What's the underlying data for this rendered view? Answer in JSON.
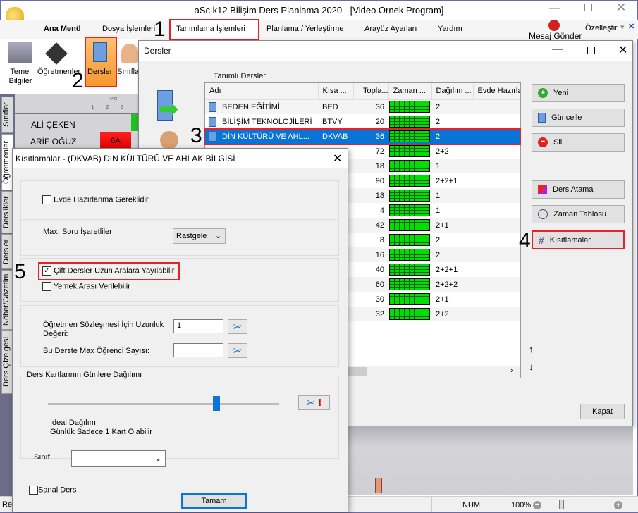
{
  "app": {
    "title": "aSc k12 Bilişim Ders Planlama 2020  - [Video Örnek Program]"
  },
  "menu": {
    "items": [
      "Ana Menü",
      "Dosya İşlemleri",
      "Tanımlama İşlemleri",
      "Planlama / Yerleştirme",
      "Arayüz Ayarları",
      "Yardım"
    ],
    "message": "Mesaj Gönder",
    "customize": "Özelleştir"
  },
  "ribbon": {
    "items": [
      "Temel Bilgiler",
      "Öğretmenler",
      "Dersler",
      "Sınıfla"
    ]
  },
  "side_tabs": [
    "Sınıflar",
    "Öğretmenler",
    "Derslikler",
    "Dersler",
    "Nöbet/Gözetim",
    "Ders Çizelgesi"
  ],
  "timetable": {
    "header": "Pzt",
    "periods": [
      "1",
      "2",
      "3"
    ],
    "rows": [
      {
        "name": "ALİ ÇEKEN"
      },
      {
        "name": "ARİF OĞUZ",
        "cell": "6A"
      }
    ]
  },
  "steps": [
    "1",
    "2",
    "3",
    "4",
    "5"
  ],
  "dersler": {
    "title": "Dersler",
    "list_label": "Tanımlı Dersler",
    "columns": [
      "Adı",
      "Kısa ...",
      "Topla...",
      "Zaman ...",
      "Dağılım ...",
      "Evde Hazırla"
    ],
    "rows": [
      {
        "name": "BEDEN EĞİTİMİ",
        "short": "BED",
        "total": "36",
        "dist": "2"
      },
      {
        "name": "BİLİŞİM TEKNOLOJİLERİ",
        "short": "BTVY",
        "total": "20",
        "dist": "2"
      },
      {
        "name": "DİN KÜLTÜRÜ VE AHL...",
        "short": "DKVAB",
        "total": "36",
        "dist": "2"
      },
      {
        "name": "",
        "short": "",
        "total": "72",
        "dist": "2+2"
      },
      {
        "name": "",
        "short": "",
        "total": "18",
        "dist": "1"
      },
      {
        "name": "",
        "short": "",
        "total": "90",
        "dist": "2+2+1"
      },
      {
        "name": "",
        "short": "",
        "total": "18",
        "dist": "1"
      },
      {
        "name": "",
        "short": "",
        "total": "4",
        "dist": "1"
      },
      {
        "name": "",
        "short": "",
        "total": "42",
        "dist": "2+1"
      },
      {
        "name": "",
        "short": "",
        "total": "8",
        "dist": "2"
      },
      {
        "name": "",
        "short": "",
        "total": "16",
        "dist": "2"
      },
      {
        "name": "",
        "short": "",
        "total": "40",
        "dist": "2+2+1"
      },
      {
        "name": "",
        "short": "",
        "total": "60",
        "dist": "2+2+2"
      },
      {
        "name": "",
        "short": "",
        "total": "30",
        "dist": "2+1"
      },
      {
        "name": "",
        "short": "",
        "total": "32",
        "dist": "2+2"
      }
    ],
    "selected_row": 2,
    "buttons": {
      "new": "Yeni",
      "update": "Güncelle",
      "delete": "Sil",
      "assign": "Ders Atama",
      "timetable": "Zaman Tablosu",
      "constraints": "Kısıtlamalar",
      "close": "Kapat"
    }
  },
  "kisit": {
    "title": "Kısıtlamalar - (DKVAB) DİN KÜLTÜRÜ VE AHLAK BİLGİSİ",
    "homework": {
      "label": "Evde Hazırlanma Gereklidir",
      "checked": false
    },
    "max_q": {
      "label": "Max. Soru İşaretliler",
      "value": "Rastgele"
    },
    "double": {
      "label": "Çift Dersler Uzun Aralara Yayılabilir",
      "checked": true
    },
    "lunch": {
      "label": "Yemek Arası Verilebilir",
      "checked": false
    },
    "contract": {
      "label": "Öğretmen Sözleşmesi İçin Uzunluk Değeri:",
      "value": "1"
    },
    "max_students": {
      "label": "Bu Derste Max Öğrenci Sayısı:",
      "value": ""
    },
    "distribution": {
      "label": "Ders Kartlarının Günlere Dağılımı",
      "slider": 0.73,
      "line1": "İdeal Dağılım",
      "line2": "Günlük Sadece 1 Kart Olabilir"
    },
    "class": {
      "label": "Sınıf",
      "value": ""
    },
    "virtual": {
      "label": "Sanal Ders",
      "checked": false
    },
    "ok": "Tamam"
  },
  "status": {
    "left": "Re",
    "num": "NUM",
    "zoom": "100%"
  }
}
